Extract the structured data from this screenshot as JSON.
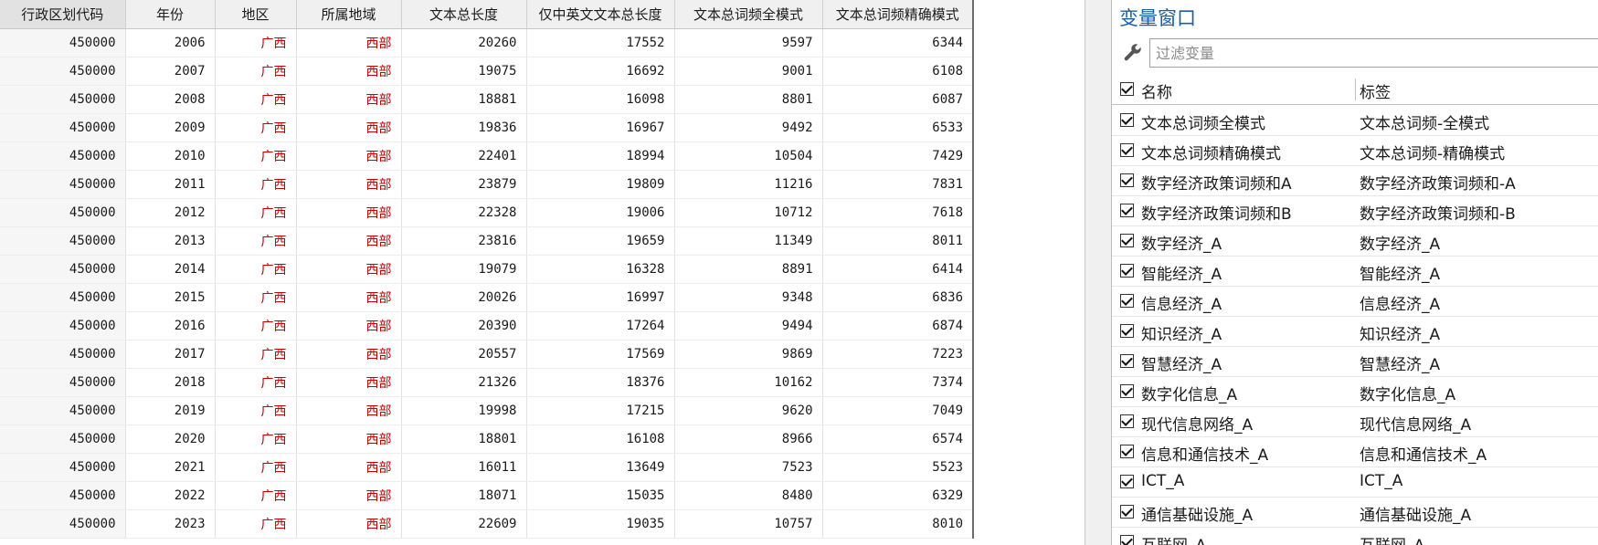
{
  "grid": {
    "columns": [
      "行政区划代码",
      "年份",
      "地区",
      "所属地域",
      "文本总长度",
      "仅中英文文本总长度",
      "文本总词频全模式",
      "文本总词频精确模式"
    ],
    "rows": [
      [
        "450000",
        "2006",
        "广西",
        "西部",
        "20260",
        "17552",
        "9597",
        "6344"
      ],
      [
        "450000",
        "2007",
        "广西",
        "西部",
        "19075",
        "16692",
        "9001",
        "6108"
      ],
      [
        "450000",
        "2008",
        "广西",
        "西部",
        "18881",
        "16098",
        "8801",
        "6087"
      ],
      [
        "450000",
        "2009",
        "广西",
        "西部",
        "19836",
        "16967",
        "9492",
        "6533"
      ],
      [
        "450000",
        "2010",
        "广西",
        "西部",
        "22401",
        "18994",
        "10504",
        "7429"
      ],
      [
        "450000",
        "2011",
        "广西",
        "西部",
        "23879",
        "19809",
        "11216",
        "7831"
      ],
      [
        "450000",
        "2012",
        "广西",
        "西部",
        "22328",
        "19006",
        "10712",
        "7618"
      ],
      [
        "450000",
        "2013",
        "广西",
        "西部",
        "23816",
        "19659",
        "11349",
        "8011"
      ],
      [
        "450000",
        "2014",
        "广西",
        "西部",
        "19079",
        "16328",
        "8891",
        "6414"
      ],
      [
        "450000",
        "2015",
        "广西",
        "西部",
        "20026",
        "16997",
        "9348",
        "6836"
      ],
      [
        "450000",
        "2016",
        "广西",
        "西部",
        "20390",
        "17264",
        "9494",
        "6874"
      ],
      [
        "450000",
        "2017",
        "广西",
        "西部",
        "20557",
        "17569",
        "9869",
        "7223"
      ],
      [
        "450000",
        "2018",
        "广西",
        "西部",
        "21326",
        "18376",
        "10162",
        "7374"
      ],
      [
        "450000",
        "2019",
        "广西",
        "西部",
        "19998",
        "17215",
        "9620",
        "7049"
      ],
      [
        "450000",
        "2020",
        "广西",
        "西部",
        "18801",
        "16108",
        "8966",
        "6574"
      ],
      [
        "450000",
        "2021",
        "广西",
        "西部",
        "16011",
        "13649",
        "7523",
        "5523"
      ],
      [
        "450000",
        "2022",
        "广西",
        "西部",
        "18071",
        "15035",
        "8480",
        "6329"
      ],
      [
        "450000",
        "2023",
        "广西",
        "西部",
        "22609",
        "19035",
        "10757",
        "8010"
      ]
    ]
  },
  "var_window": {
    "title": "变量窗口",
    "filter_placeholder": "过滤变量",
    "header_name": "名称",
    "header_label": "标签",
    "variables": [
      {
        "name": "文本总词频全模式",
        "label": "文本总词频-全模式"
      },
      {
        "name": "文本总词频精确模式",
        "label": "文本总词频-精确模式"
      },
      {
        "name": "数字经济政策词频和A",
        "label": "数字经济政策词频和-A"
      },
      {
        "name": "数字经济政策词频和B",
        "label": "数字经济政策词频和-B"
      },
      {
        "name": "数字经济_A",
        "label": "数字经济_A"
      },
      {
        "name": "智能经济_A",
        "label": "智能经济_A"
      },
      {
        "name": "信息经济_A",
        "label": "信息经济_A"
      },
      {
        "name": "知识经济_A",
        "label": "知识经济_A"
      },
      {
        "name": "智慧经济_A",
        "label": "智慧经济_A"
      },
      {
        "name": "数字化信息_A",
        "label": "数字化信息_A"
      },
      {
        "name": "现代信息网络_A",
        "label": "现代信息网络_A"
      },
      {
        "name": "信息和通信技术_A",
        "label": "信息和通信技术_A"
      },
      {
        "name": "ICT_A",
        "label": "ICT_A"
      },
      {
        "name": "通信基础设施_A",
        "label": "通信基础设施_A"
      },
      {
        "name": "互联网_A",
        "label": "互联网_A"
      }
    ]
  },
  "icons": {
    "filter": "wrench-icon",
    "checkbox": "checkbox-checked-icon"
  },
  "colors": {
    "title_blue": "#1a5fa8",
    "cell_red": "#c00000",
    "header_bg": "#f0f0f0"
  }
}
